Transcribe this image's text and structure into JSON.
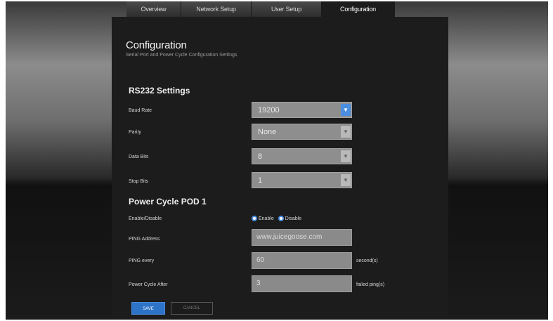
{
  "tabs": [
    {
      "label": "Overview"
    },
    {
      "label": "Network Setup"
    },
    {
      "label": "User Setup"
    },
    {
      "label": "Configuration"
    }
  ],
  "page": {
    "title": "Configuration",
    "subtitle": "Serial Port and Power Cycle Configuration Settings"
  },
  "rs232": {
    "title": "RS232 Settings",
    "baud_rate": {
      "label": "Baud Rate",
      "value": "19200"
    },
    "parity": {
      "label": "Parity",
      "value": "None"
    },
    "data_bits": {
      "label": "Data Bits",
      "value": "8"
    },
    "stop_bits": {
      "label": "Stop Bits",
      "value": "1"
    }
  },
  "power_cycle": {
    "title": "Power Cycle POD 1",
    "enable": {
      "label": "Enable/Disable",
      "enable_label": "Enable",
      "disable_label": "Disable"
    },
    "ping_address": {
      "label": "PING Address",
      "value": "www.juicegoose.com"
    },
    "ping_every": {
      "label": "PING every",
      "value": "60",
      "suffix": "second(s)"
    },
    "power_cycle_after": {
      "label": "Power Cycle After",
      "value": "3",
      "suffix": "failed ping(s)"
    }
  },
  "buttons": {
    "save": "SAVE",
    "cancel": "CANCEL"
  },
  "colors": {
    "accent": "#2d73c8",
    "panel": "#1c1c1c"
  }
}
